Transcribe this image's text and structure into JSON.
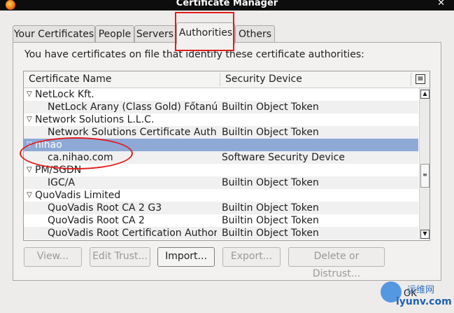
{
  "window": {
    "title": "Certificate Manager"
  },
  "tabs": [
    {
      "label": "Your Certificates"
    },
    {
      "label": "People"
    },
    {
      "label": "Servers"
    },
    {
      "label": "Authorities"
    },
    {
      "label": "Others"
    }
  ],
  "active_tab": "Authorities",
  "intro": "You have certificates on file that identify these certificate authorities:",
  "columns": {
    "name": "Certificate Name",
    "device": "Security Device"
  },
  "rows": [
    {
      "name": "NetLock Kft.",
      "device": "",
      "group": true
    },
    {
      "name": "NetLock Arany (Class Gold) Főtanú...",
      "device": "Builtin Object Token",
      "group": false
    },
    {
      "name": "Network Solutions L.L.C.",
      "device": "",
      "group": true
    },
    {
      "name": "Network Solutions Certificate Auth...",
      "device": "Builtin Object Token",
      "group": false
    },
    {
      "name": "nihao",
      "device": "",
      "group": true,
      "selected": true
    },
    {
      "name": "ca.nihao.com",
      "device": "Software Security Device",
      "group": false
    },
    {
      "name": "PM/SGDN",
      "device": "",
      "group": true
    },
    {
      "name": "IGC/A",
      "device": "Builtin Object Token",
      "group": false
    },
    {
      "name": "QuoVadis Limited",
      "device": "",
      "group": true
    },
    {
      "name": "QuoVadis Root CA 2 G3",
      "device": "Builtin Object Token",
      "group": false
    },
    {
      "name": "QuoVadis Root CA 2",
      "device": "Builtin Object Token",
      "group": false
    },
    {
      "name": "QuoVadis Root Certification Authority",
      "device": "Builtin Object Token",
      "group": false
    }
  ],
  "buttons": {
    "view": "View...",
    "edit": "Edit Trust...",
    "import": "Import...",
    "export": "Export...",
    "delete": "Delete or Distrust..."
  },
  "watermark": {
    "ok": "OK",
    "site_cn": "运维网",
    "site": "iyunv.com"
  },
  "colors": {
    "selection": "#8fa9d6",
    "annotation": "#e21c1c"
  }
}
